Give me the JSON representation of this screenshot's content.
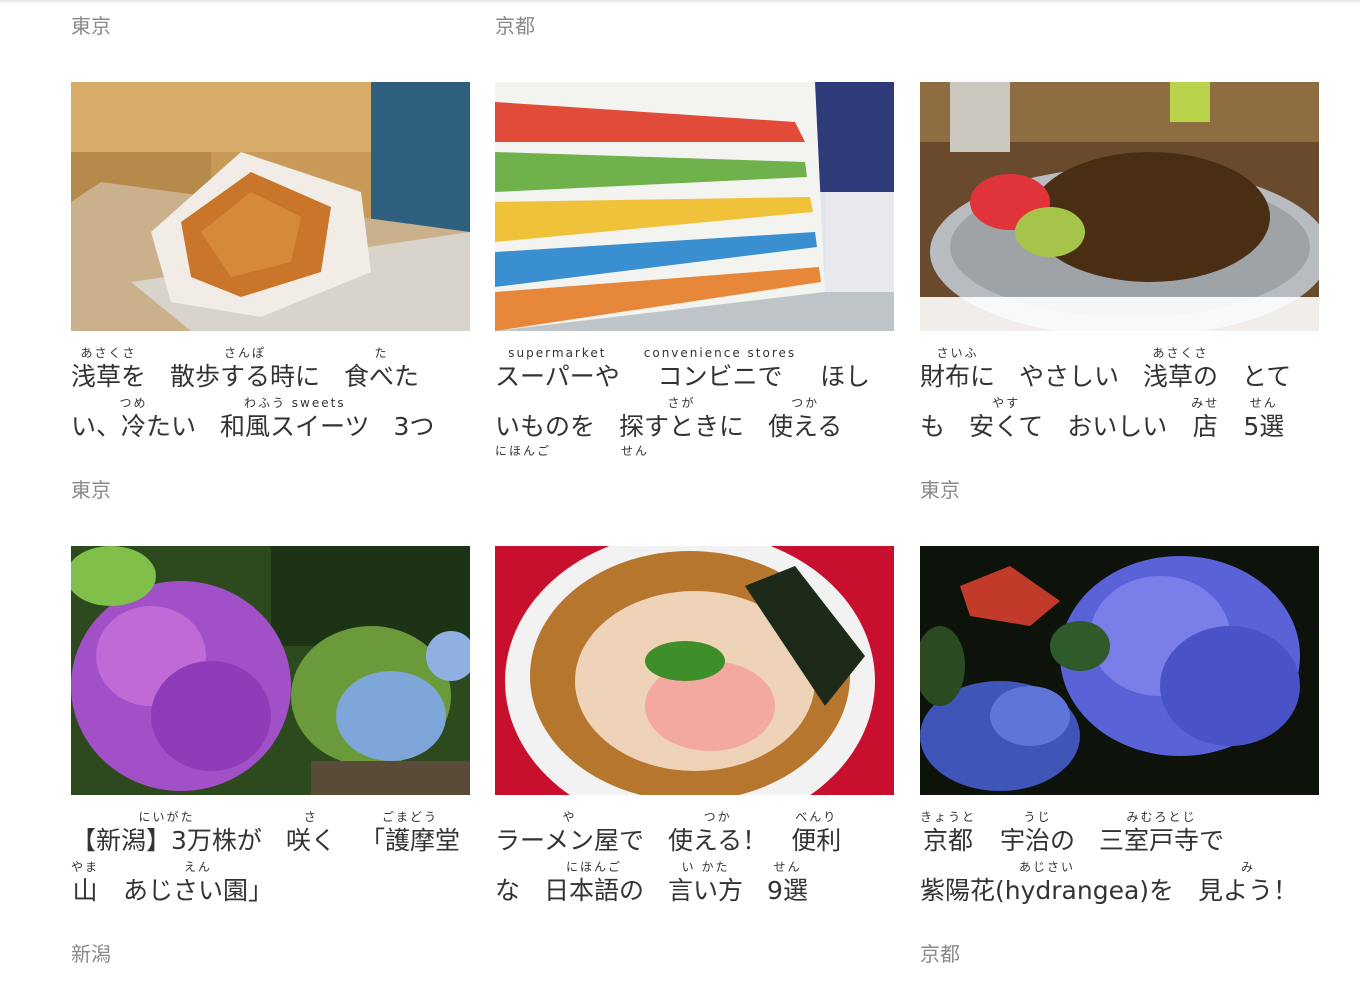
{
  "regions_top": [
    "東京",
    "京都"
  ],
  "cards": [
    {
      "region": "東京",
      "image": "wafu-sweets-photo",
      "lines": [
        [
          {
            "rt": "あさくさ",
            "rb": "浅草を"
          },
          {
            "rt": "さんぽ",
            "rb": "散歩する時に"
          },
          {
            "rt": "た",
            "rb": "食べた"
          }
        ],
        [
          {
            "rt": "つめ",
            "rb": "い、冷たい"
          },
          {
            "rt": "わふう   sweets",
            "rb": "和風スイーツ"
          },
          {
            "rt": "",
            "rb": "3つ"
          }
        ]
      ]
    },
    {
      "region": "",
      "image": "supermarket-shelves-photo",
      "lines": [
        [
          {
            "rt": "supermarket",
            "rb": "スーパーや"
          },
          {
            "rt": "convenience stores",
            "rb": "コンビニで"
          },
          {
            "rt": "",
            "rb": "ほし"
          }
        ],
        [
          {
            "rt": "",
            "rb": "いものを"
          },
          {
            "rt": "さが",
            "rb": "探すときに"
          },
          {
            "rt": "つか",
            "rb": "使える"
          }
        ],
        [
          {
            "rt": "にほんご",
            "rb": ""
          },
          {
            "rt": "せん",
            "rb": ""
          }
        ]
      ]
    },
    {
      "region": "東京",
      "image": "yakisoba-plate-photo",
      "lines": [
        [
          {
            "rt": "さいふ",
            "rb": "財布に"
          },
          {
            "rt": "",
            "rb": "やさしい"
          },
          {
            "rt": "あさくさ",
            "rb": "浅草の"
          },
          {
            "rt": "",
            "rb": "とて"
          }
        ],
        [
          {
            "rt": "",
            "rb": "も"
          },
          {
            "rt": "やす",
            "rb": "安くて"
          },
          {
            "rt": "",
            "rb": "おいしい"
          },
          {
            "rt": "みせ",
            "rb": "店"
          },
          {
            "rt": "せん",
            "rb": "5選"
          }
        ]
      ]
    },
    {
      "region": "新潟",
      "image": "purple-hydrangea-photo",
      "lines": [
        [
          {
            "rt": "にいがた",
            "rb": "【新潟】3万株が"
          },
          {
            "rt": "さ",
            "rb": "咲く"
          },
          {
            "rt": "ごまどう",
            "rb": "「護摩堂"
          }
        ],
        [
          {
            "rt": "やま",
            "rb": "山"
          },
          {
            "rt": "えん",
            "rb": "あじさい園」"
          }
        ]
      ]
    },
    {
      "region": "",
      "image": "ramen-bowl-photo",
      "lines": [
        [
          {
            "rt": "や",
            "rb": "ラーメン屋で"
          },
          {
            "rt": "つか",
            "rb": "使える！"
          },
          {
            "rt": "べんり",
            "rb": "便利"
          }
        ],
        [
          {
            "rt": "",
            "rb": "な"
          },
          {
            "rt": "にほんご",
            "rb": "日本語の"
          },
          {
            "rt": "い かた",
            "rb": "言い方"
          },
          {
            "rt": "せん",
            "rb": "9選"
          }
        ]
      ]
    },
    {
      "region": "京都",
      "image": "blue-hydrangea-photo",
      "lines": [
        [
          {
            "rt": "きょうと",
            "rb": "京都"
          },
          {
            "rt": "うじ",
            "rb": "宇治の"
          },
          {
            "rt": "みむろとじ",
            "rb": "三室戸寺で"
          }
        ],
        [
          {
            "rt": "あじさい",
            "rb": "紫陽花(hydrangea)を"
          },
          {
            "rt": "み",
            "rb": "見よう！"
          }
        ]
      ]
    }
  ],
  "colors": {
    "region_text": "#8a8a8a",
    "title_text": "#333333",
    "background": "#ffffff"
  }
}
